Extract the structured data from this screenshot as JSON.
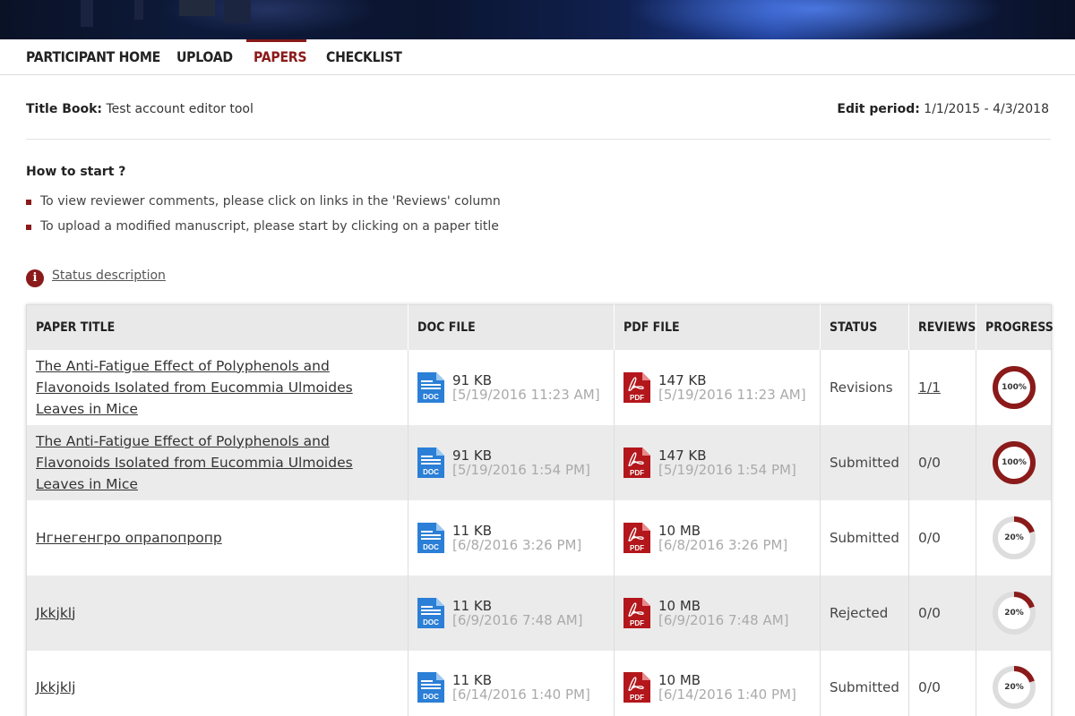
{
  "nav": {
    "items": [
      {
        "label": "PARTICIPANT HOME",
        "active": false
      },
      {
        "label": "UPLOAD",
        "active": false
      },
      {
        "label": "PAPERS",
        "active": true
      },
      {
        "label": "CHECKLIST",
        "active": false
      }
    ]
  },
  "meta": {
    "title_book_label": "Title Book:",
    "title_book_value": "Test account editor tool",
    "edit_period_label": "Edit period:",
    "edit_period_value": "1/1/2015 - 4/3/2018"
  },
  "howto": {
    "title": "How to start ?",
    "items": [
      "To view reviewer comments, please click on links in the 'Reviews' column",
      "To upload a modified manuscript, please start by clicking on a paper title"
    ]
  },
  "status_description": {
    "icon": "info-icon",
    "icon_glyph": "i",
    "label": "Status description"
  },
  "table": {
    "headers": {
      "paper_title": "PAPER TITLE",
      "doc_file": "DOC FILE",
      "pdf_file": "PDF FILE",
      "status": "STATUS",
      "reviews": "REVIEWS",
      "progress": "PROGRESS"
    },
    "rows": [
      {
        "title": "The Anti-Fatigue Effect of Polyphenols and Flavonoids Isolated from Eucommia Ulmoides Leaves in Mice",
        "doc_size": "91 KB",
        "doc_date": "[5/19/2016 11:23 AM]",
        "pdf_size": "147 KB",
        "pdf_date": "[5/19/2016 11:23 AM]",
        "status": "Revisions",
        "reviews": "1/1",
        "reviews_link": true,
        "progress": 1.0,
        "progress_label": "100%"
      },
      {
        "title": "The Anti-Fatigue Effect of Polyphenols and Flavonoids Isolated from Eucommia Ulmoides Leaves in Mice",
        "doc_size": "91 KB",
        "doc_date": "[5/19/2016 1:54 PM]",
        "pdf_size": "147 KB",
        "pdf_date": "[5/19/2016 1:54 PM]",
        "status": "Submitted",
        "reviews": "0/0",
        "reviews_link": false,
        "progress": 1.0,
        "progress_label": "100%"
      },
      {
        "title": "Нгнегенгро опрапопропр",
        "doc_size": "11 KB",
        "doc_date": "[6/8/2016 3:26 PM]",
        "pdf_size": "10 MB",
        "pdf_date": "[6/8/2016 3:26 PM]",
        "status": "Submitted",
        "reviews": "0/0",
        "reviews_link": false,
        "progress": 0.2,
        "progress_label": "20%"
      },
      {
        "title": "Jkkjklj",
        "doc_size": "11 KB",
        "doc_date": "[6/9/2016 7:48 AM]",
        "pdf_size": "10 MB",
        "pdf_date": "[6/9/2016 7:48 AM]",
        "status": "Rejected",
        "reviews": "0/0",
        "reviews_link": false,
        "progress": 0.2,
        "progress_label": "20%"
      },
      {
        "title": "Jkkjklj",
        "doc_size": "11 KB",
        "doc_date": "[6/14/2016 1:40 PM]",
        "pdf_size": "10 MB",
        "pdf_date": "[6/14/2016 1:40 PM]",
        "status": "Submitted",
        "reviews": "0/0",
        "reviews_link": false,
        "progress": 0.2,
        "progress_label": "20%"
      }
    ]
  },
  "icons": {
    "doc": {
      "name": "doc-file-icon",
      "label": "DOC",
      "color": "#2b7fd6"
    },
    "pdf": {
      "name": "pdf-file-icon",
      "label": "PDF",
      "color": "#b3171b"
    }
  },
  "colors": {
    "accent": "#8b1a1a",
    "progress_track": "#dddddd",
    "progress_fill": "#8b1a1a"
  }
}
